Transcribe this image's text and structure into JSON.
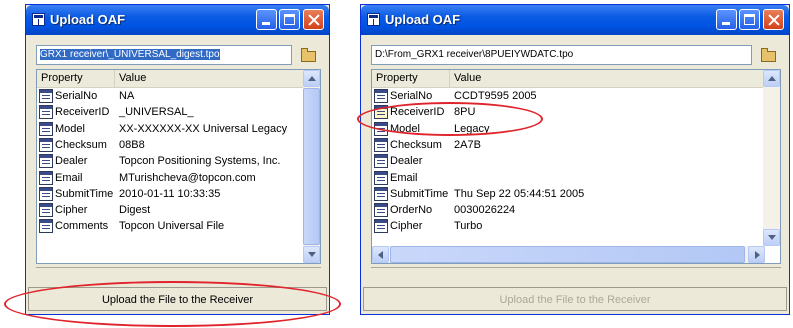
{
  "colors": {
    "annotation": "#e0242c",
    "titlebar": "#0054e3",
    "window_bg": "#ece9d8"
  },
  "left_window": {
    "title": "Upload OAF",
    "path_value": "GRX1 receiver\\_UNIVERSAL_digest.tpo",
    "columns": {
      "property": "Property",
      "value": "Value"
    },
    "rows": [
      {
        "property": "SerialNo",
        "value": "NA"
      },
      {
        "property": "ReceiverID",
        "value": "_UNIVERSAL_"
      },
      {
        "property": "Model",
        "value": "XX-XXXXXX-XX Universal Legacy"
      },
      {
        "property": "Checksum",
        "value": "08B8"
      },
      {
        "property": "Dealer",
        "value": "Topcon Positioning Systems, Inc."
      },
      {
        "property": "Email",
        "value": "MTurishcheva@topcon.com"
      },
      {
        "property": "SubmitTime",
        "value": "2010-01-11 10:33:35"
      },
      {
        "property": "Cipher",
        "value": "Digest"
      },
      {
        "property": "Comments",
        "value": "Topcon Universal File"
      }
    ],
    "upload_label": "Upload the File to the Receiver"
  },
  "right_window": {
    "title": "Upload OAF",
    "path_value": "D:\\From_GRX1 receiver\\8PUEIYWDATC.tpo",
    "columns": {
      "property": "Property",
      "value": "Value"
    },
    "rows": [
      {
        "property": "SerialNo",
        "value": "CCDT9595 2005"
      },
      {
        "property": "ReceiverID",
        "value": "8PU"
      },
      {
        "property": "Model",
        "value": "Legacy"
      },
      {
        "property": "Checksum",
        "value": "2A7B"
      },
      {
        "property": "Dealer",
        "value": ""
      },
      {
        "property": "Email",
        "value": ""
      },
      {
        "property": "SubmitTime",
        "value": "Thu Sep 22 05:44:51 2005"
      },
      {
        "property": "OrderNo",
        "value": "0030026224"
      },
      {
        "property": "Cipher",
        "value": "Turbo"
      }
    ],
    "upload_label": "Upload the File to the Receiver"
  }
}
